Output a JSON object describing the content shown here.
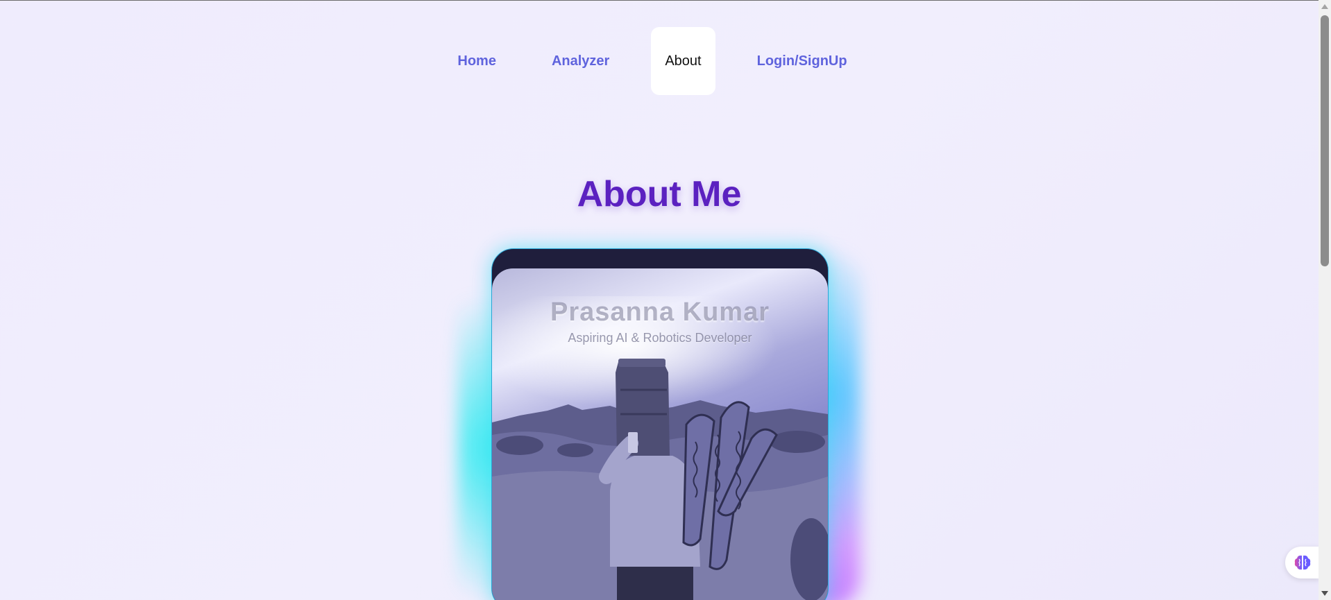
{
  "nav": {
    "items": [
      {
        "label": "Home",
        "active": false
      },
      {
        "label": "Analyzer",
        "active": false
      },
      {
        "label": "About",
        "active": true
      },
      {
        "label": "Login/SignUp",
        "active": false
      }
    ]
  },
  "page": {
    "title": "About Me"
  },
  "profile_card": {
    "name": "Prasanna Kumar",
    "subtitle": "Aspiring AI & Robotics Developer"
  },
  "floating_button": {
    "icon": "brain-icon"
  },
  "colors": {
    "nav_link": "#5f63dd",
    "title": "#5b21c0",
    "card_glow_cyan": "#28ebf0",
    "card_glow_purple": "#c878ff"
  }
}
